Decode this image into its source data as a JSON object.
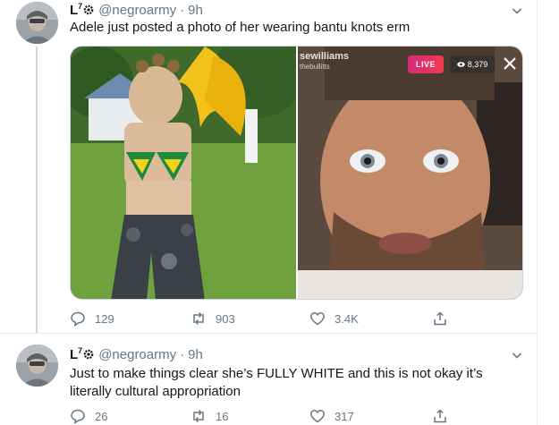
{
  "tweets": [
    {
      "display_name": "L",
      "badge": "7",
      "handle": "@negroarmy",
      "separator": "·",
      "time": "9h",
      "text": "Adele just posted a photo of her wearing bantu knots erm",
      "icons": {
        "avatar": "avatar",
        "settings": "gear-icon",
        "caret": "chevron-down-icon"
      },
      "media": {
        "live_user": "sewilliams",
        "live_sub": "thebullitts",
        "live_label": "LIVE",
        "viewer_count": "8,379",
        "close_icon": "close-icon"
      },
      "actions": {
        "replies": "129",
        "retweets": "903",
        "likes": "3.4K"
      }
    },
    {
      "display_name": "L",
      "badge": "7",
      "handle": "@negroarmy",
      "separator": "·",
      "time": "9h",
      "text": "Just to make things clear she’s FULLY WHITE and this is not okay it’s literally cultural appropriation",
      "icons": {
        "avatar": "avatar",
        "settings": "gear-icon",
        "caret": "chevron-down-icon"
      },
      "actions": {
        "replies": "26",
        "retweets": "16",
        "likes": "317"
      }
    }
  ],
  "colors": {
    "text_primary": "#14171a",
    "text_secondary": "#657786",
    "border": "#e6ecf0",
    "thread_line": "#ccd6dd",
    "live_gradient_start": "#d62a7b",
    "live_gradient_end": "#f0394f"
  }
}
